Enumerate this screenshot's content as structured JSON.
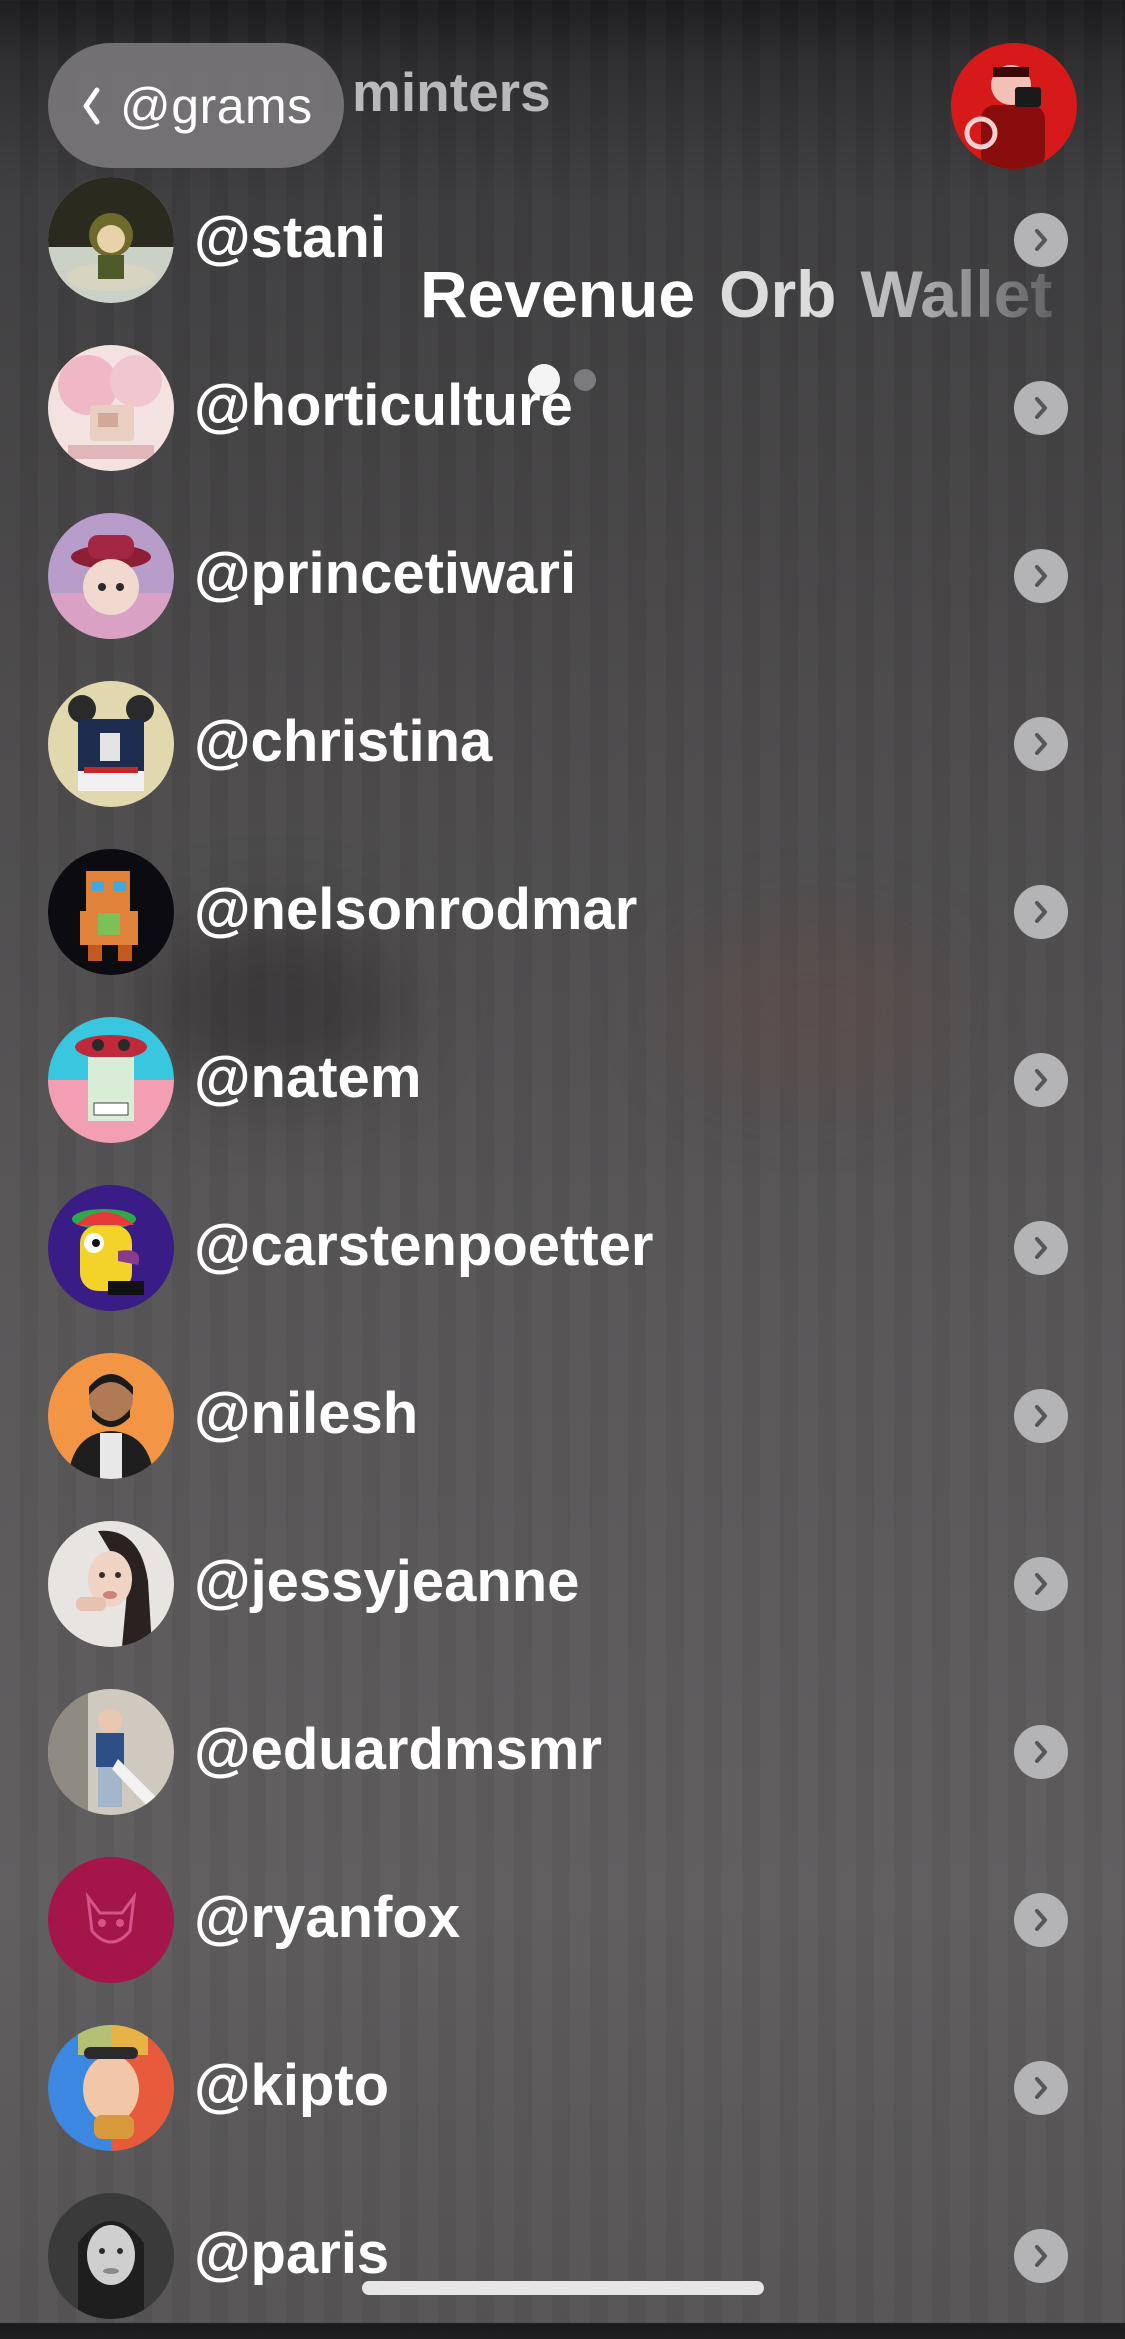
{
  "header": {
    "back_label": "@grams",
    "title": "minters",
    "profile_avatar_desc": "profile-avatar"
  },
  "overlay_tabs": [
    "Revenue",
    "Orb",
    "Wallet"
  ],
  "page_indicator": {
    "count": 2,
    "active_index": 0
  },
  "minters": [
    {
      "handle": "@stani",
      "avatar_colors": [
        "#2a2a1e",
        "#cbd1c6"
      ]
    },
    {
      "handle": "@horticulture",
      "avatar_colors": [
        "#efcfd4",
        "#f3e2df"
      ]
    },
    {
      "handle": "@princetiwari",
      "avatar_colors": [
        "#8d7fa8",
        "#d9a1c4"
      ]
    },
    {
      "handle": "@christina",
      "avatar_colors": [
        "#e2d8ae",
        "#1d2c4f"
      ]
    },
    {
      "handle": "@nelsonrodmar",
      "avatar_colors": [
        "#0b0b10",
        "#e0823a"
      ]
    },
    {
      "handle": "@natem",
      "avatar_colors": [
        "#38c7df",
        "#f29fb3"
      ]
    },
    {
      "handle": "@carstenpoetter",
      "avatar_colors": [
        "#3a1c86",
        "#f3d22a"
      ]
    },
    {
      "handle": "@nilesh",
      "avatar_colors": [
        "#f29545",
        "#1e1e1e"
      ]
    },
    {
      "handle": "@jessyjeanne",
      "avatar_colors": [
        "#e8e4e1",
        "#2a2220"
      ]
    },
    {
      "handle": "@eduardmsmr",
      "avatar_colors": [
        "#cfc9bf",
        "#2d4f86"
      ]
    },
    {
      "handle": "@ryanfox",
      "avatar_colors": [
        "#a4154a",
        "#d6548a"
      ]
    },
    {
      "handle": "@kipto",
      "avatar_colors": [
        "#e85a3c",
        "#3c87e0"
      ]
    },
    {
      "handle": "@paris",
      "avatar_colors": [
        "#3a3a3a",
        "#cfcfcf"
      ]
    }
  ],
  "colors": {
    "chevron_bg": "#b4b3b5",
    "back_pill_bg": "#787678",
    "text": "#ffffff"
  }
}
